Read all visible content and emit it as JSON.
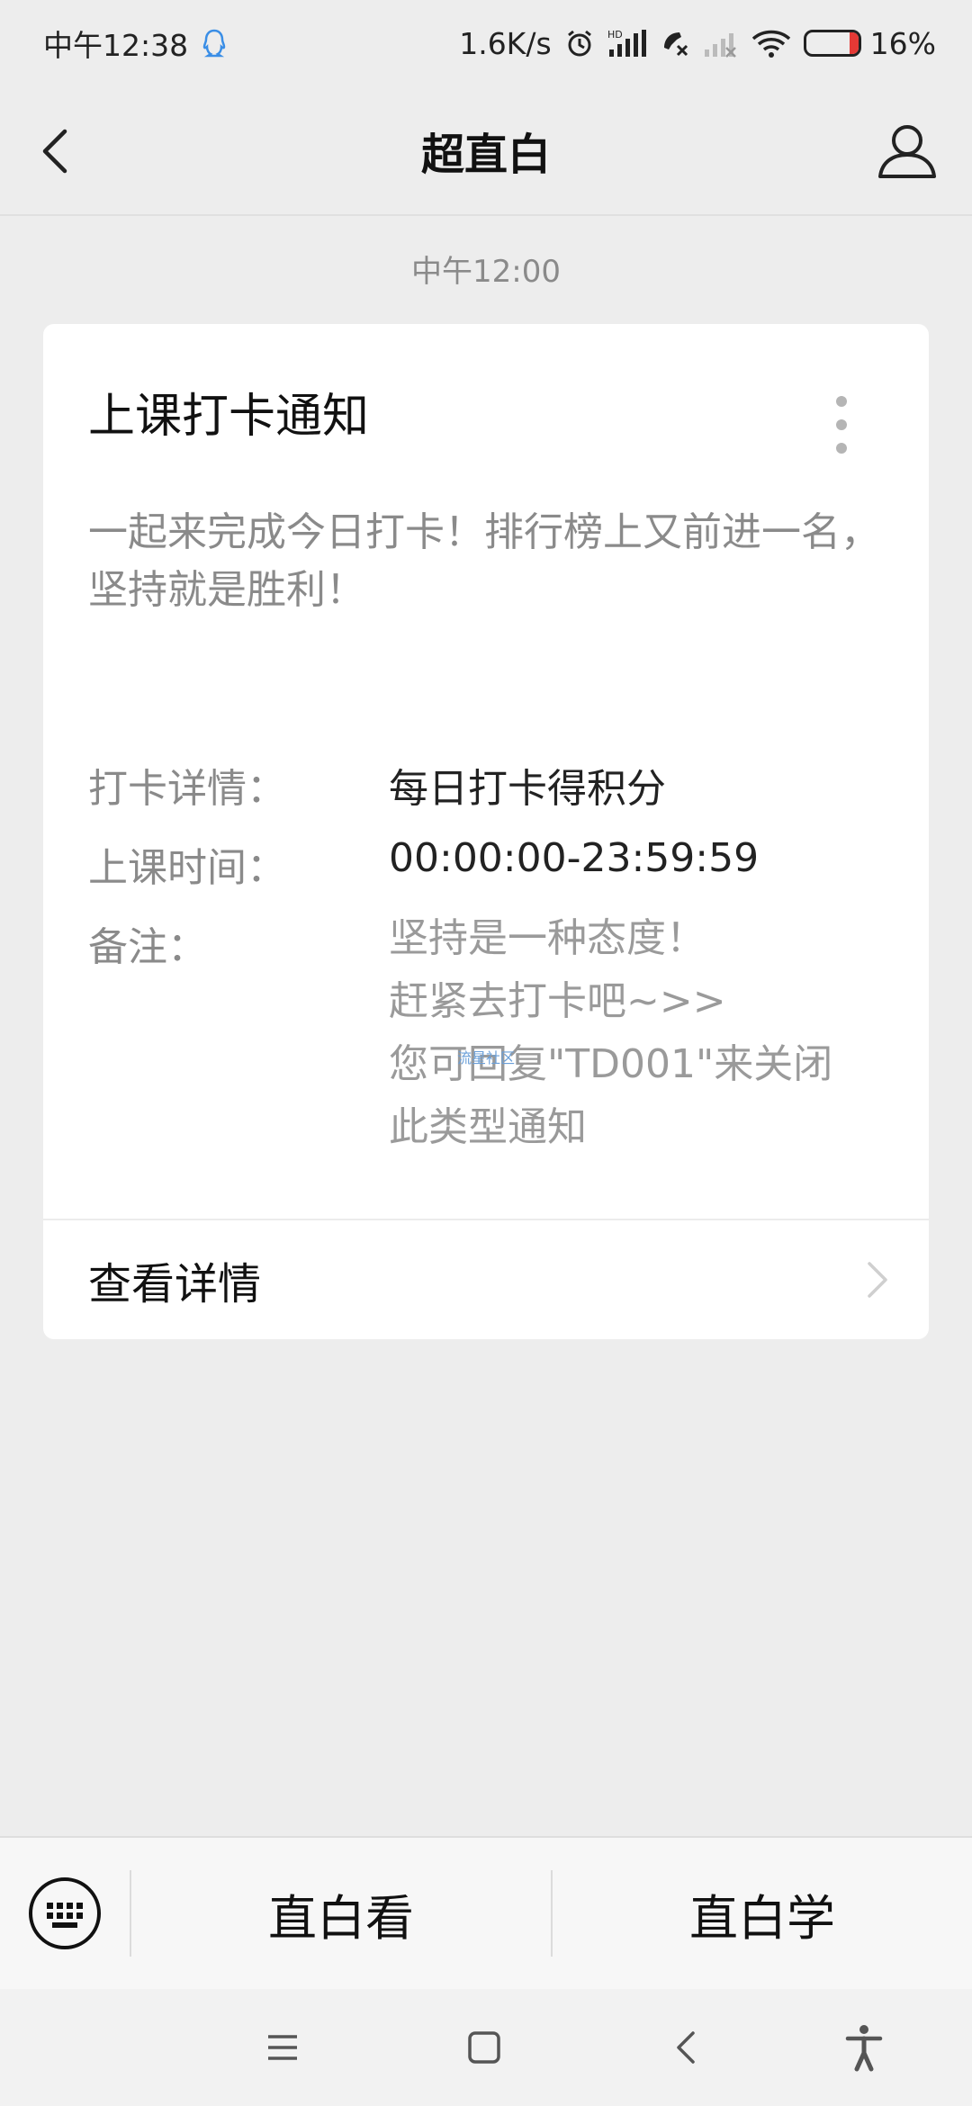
{
  "status_bar": {
    "time": "中午12:38",
    "net_speed": "1.6K/s",
    "hd_label": "HD",
    "battery_percent": "16%",
    "battery_level": 0.16
  },
  "nav": {
    "title": "超直白"
  },
  "message": {
    "timestamp": "中午12:00",
    "card": {
      "title": "上课打卡通知",
      "description": "一起来完成今日打卡！排行榜上又前进一名，坚持就是胜利！",
      "rows": [
        {
          "label": "打卡详情：",
          "value": "每日打卡得积分"
        },
        {
          "label": "上课时间：",
          "value": "00:00:00-23:59:59"
        },
        {
          "label": "备注：",
          "lines": [
            "坚持是一种态度！",
            "赶紧去打卡吧~>>",
            "您可回复\"TD001\"来关闭",
            "此类型通知"
          ]
        }
      ],
      "watermark": "流星社区",
      "footer_label": "查看详情"
    }
  },
  "bottom_menu": {
    "items": [
      "直白看",
      "直白学"
    ]
  },
  "colors": {
    "background": "#ededed",
    "card": "#ffffff",
    "muted_text": "#8a8a8a",
    "battery_low": "#e53935",
    "notify_icon": "#3a8ee6"
  }
}
